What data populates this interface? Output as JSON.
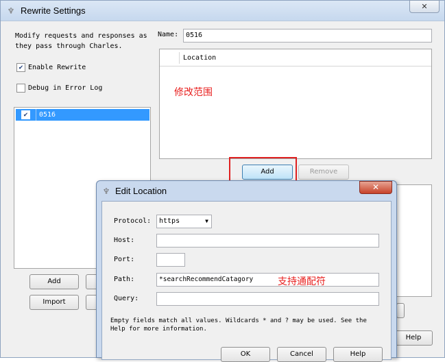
{
  "window": {
    "title": "Rewrite Settings",
    "description": "Modify requests and responses as\nthey pass through Charles.",
    "enable_rewrite": {
      "label": "Enable Rewrite",
      "checked": true
    },
    "debug_log": {
      "label": "Debug in Error Log",
      "checked": false
    },
    "rules": [
      {
        "name": "0516",
        "checked": true
      }
    ],
    "left_buttons": {
      "add": "Add",
      "import": "Import"
    },
    "name": {
      "label": "Name:",
      "value": "0516"
    },
    "location_table": {
      "column": "Location",
      "annotation": "修改范围"
    },
    "location_buttons": {
      "add": "Add",
      "remove": "Remove"
    },
    "help": "Help"
  },
  "dialog": {
    "title": "Edit Location",
    "protocol": {
      "label": "Protocol:",
      "value": "https"
    },
    "host": {
      "label": "Host:",
      "value": ""
    },
    "port": {
      "label": "Port:",
      "value": ""
    },
    "path": {
      "label": "Path:",
      "value": "*searchRecommendCatagory",
      "annotation": "支持通配符"
    },
    "query": {
      "label": "Query:",
      "value": ""
    },
    "hint": "Empty fields match all values. Wildcards * and ? may be used. See the Help for more information.",
    "buttons": {
      "ok": "OK",
      "cancel": "Cancel",
      "help": "Help"
    }
  },
  "colors": {
    "annotation_red": "#e8201f",
    "selection_blue": "#3399ff"
  },
  "icons": {
    "app": "app-icon",
    "close": "close-icon",
    "check": "check-icon",
    "dropdown": "chevron-down-icon"
  }
}
